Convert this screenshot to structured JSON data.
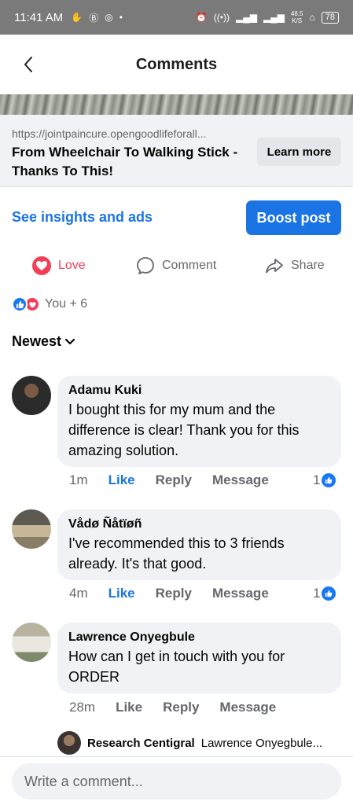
{
  "status_bar": {
    "time": "11:41 AM",
    "network_speed": "48.5\nK/S",
    "battery": "78"
  },
  "header": {
    "title": "Comments"
  },
  "link_card": {
    "url": "https://jointpaincure.opengoodlifeforall...",
    "title": "From Wheelchair To Walking Stick - Thanks To This!",
    "cta_label": "Learn more"
  },
  "promo": {
    "insights_label": "See insights and ads",
    "boost_label": "Boost post"
  },
  "actions": {
    "love_label": "Love",
    "comment_label": "Comment",
    "share_label": "Share"
  },
  "reactions": {
    "summary": "You + 6"
  },
  "sort": {
    "label": "Newest"
  },
  "comments": [
    {
      "author": "Adamu Kuki",
      "text": "I bought this for my mum and the difference is clear! Thank you for this amazing solution.",
      "time": "1m",
      "like_label": "Like",
      "reply_label": "Reply",
      "message_label": "Message",
      "like_count": "1"
    },
    {
      "author": "Vådø Ñåtïøñ",
      "text": "I've recommended this to 3 friends already. It's that good.",
      "time": "4m",
      "like_label": "Like",
      "reply_label": "Reply",
      "message_label": "Message",
      "like_count": "1"
    },
    {
      "author": "Lawrence Onyegbule",
      "text": "How can I get in touch with you for ORDER",
      "time": "28m",
      "like_label": "Like",
      "reply_label": "Reply",
      "message_label": "Message"
    }
  ],
  "reply_preview": {
    "author": "Research Centigral",
    "text": "Lawrence Onyegbule..."
  },
  "composer": {
    "placeholder": "Write a comment..."
  },
  "colors": {
    "accent_blue": "#1b74e4",
    "love_red": "#f33e58",
    "bubble_gray": "#f0f2f5"
  }
}
